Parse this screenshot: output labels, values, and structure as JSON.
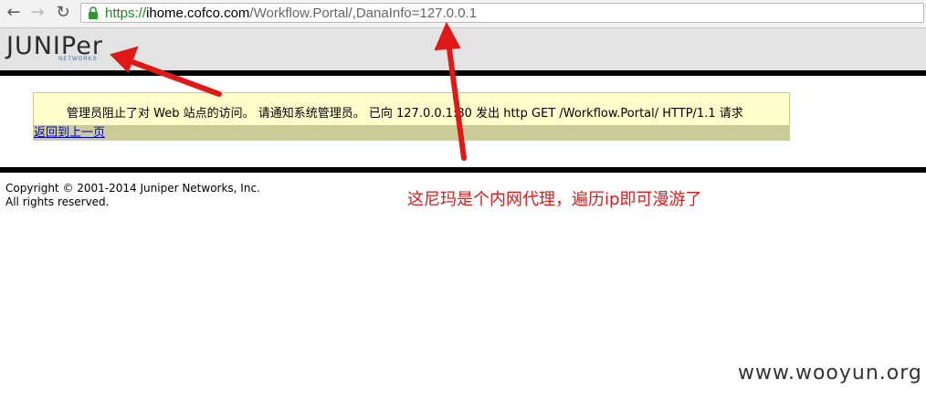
{
  "browser": {
    "back_glyph": "←",
    "forward_glyph": "→",
    "reload_glyph": "↻",
    "url": {
      "scheme": "https://",
      "host": "ihome.cofco.com",
      "path": "/Workflow.Portal/,DanaInfo=127.0.0.1"
    },
    "icons": [
      "back-arrow-icon",
      "forward-arrow-icon",
      "reload-icon",
      "lock-icon"
    ]
  },
  "header": {
    "logo_text": "JUNIPer",
    "logo_subtext": "NETWORKS"
  },
  "message": {
    "text": "管理员阻止了对 Web 站点的访问。 请通知系统管理员。 已向 127.0.0.1:80 发出 http GET /Workflow.Portal/ HTTP/1.1 请求",
    "back_link": "返回到上一页"
  },
  "footer": {
    "copyright_line1": "Copyright © 2001-2014 Juniper Networks, Inc.",
    "copyright_line2": "All rights reserved."
  },
  "annotation": {
    "text": "这尼玛是个内网代理，遍历ip即可漫游了",
    "color": "#e01818"
  },
  "watermark": "www.wooyun.org",
  "colors": {
    "message_bg": "#ffffcc",
    "back_bar_bg": "#cccc99",
    "link": "#0000cc",
    "secure_scheme": "#1a8b1a"
  }
}
